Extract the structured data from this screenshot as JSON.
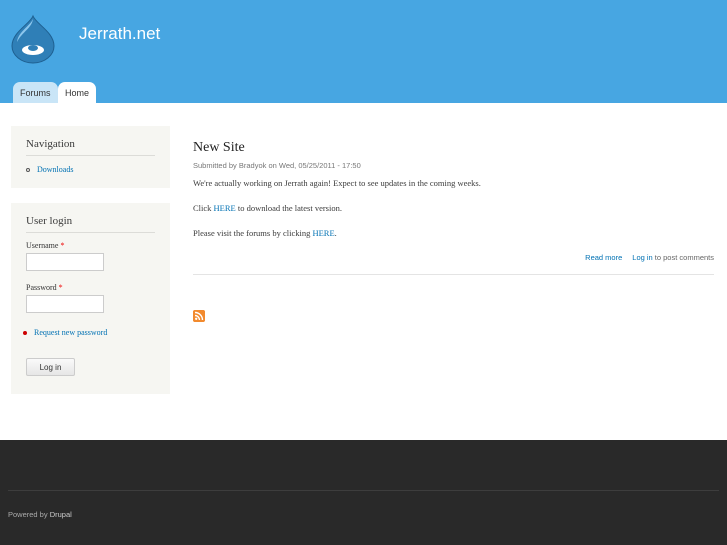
{
  "site": {
    "name": "Jerrath.net"
  },
  "tabs": [
    {
      "label": "Forums"
    },
    {
      "label": "Home"
    }
  ],
  "navigation": {
    "title": "Navigation",
    "items": [
      {
        "label": "Downloads"
      }
    ]
  },
  "login": {
    "title": "User login",
    "username_label": "Username",
    "password_label": "Password",
    "required": "*",
    "request_password": "Request new password",
    "submit": "Log in"
  },
  "node": {
    "title": "New Site",
    "meta": "Submitted by Bradyok on Wed, 05/25/2011 - 17:50",
    "p1": "We're actually working on Jerrath again! Expect to see updates in the coming weeks.",
    "p2_pre": "Click ",
    "p2_link": "HERE",
    "p2_post": " to download the latest version.",
    "p3_pre": "Please visit the forums by clicking ",
    "p3_link": "HERE",
    "p3_post": ".",
    "read_more": "Read more",
    "log_in": "Log in",
    "post_comments": " to post comments"
  },
  "footer": {
    "powered_by": "Powered by ",
    "drupal": "Drupal"
  }
}
